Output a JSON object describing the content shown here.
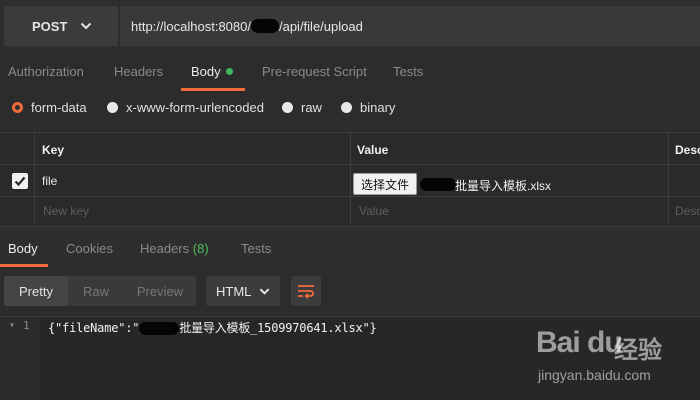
{
  "request": {
    "method": "POST",
    "url_prefix": "http://localhost:8080/",
    "url_suffix": "/api/file/upload"
  },
  "request_tabs": [
    {
      "label": "Authorization"
    },
    {
      "label": "Headers"
    },
    {
      "label": "Body",
      "active": true,
      "indicator_color": "#3fb85c"
    },
    {
      "label": "Pre-request Script"
    },
    {
      "label": "Tests"
    }
  ],
  "body_types": [
    {
      "label": "form-data",
      "selected": true
    },
    {
      "label": "x-www-form-urlencoded"
    },
    {
      "label": "raw"
    },
    {
      "label": "binary"
    }
  ],
  "params_table": {
    "columns": [
      "Key",
      "Value",
      "Desc"
    ],
    "rows": [
      {
        "checked": true,
        "key": "file",
        "file_button": "选择文件",
        "file_name": "批量导入模板.xlsx"
      }
    ],
    "placeholders": {
      "key": "New key",
      "value": "Value",
      "description": "Desc"
    }
  },
  "response_tabs": [
    {
      "label": "Body",
      "active": true
    },
    {
      "label": "Cookies"
    },
    {
      "label": "Headers",
      "count": "(8)"
    },
    {
      "label": "Tests"
    }
  ],
  "view_modes": [
    {
      "label": "Pretty",
      "selected": true
    },
    {
      "label": "Raw"
    },
    {
      "label": "Preview"
    }
  ],
  "format": "HTML",
  "response_body": {
    "line_number": "1",
    "prefix": "{\"fileName\":\"",
    "suffix": "批量导入模板_1509970641.xlsx\"}"
  },
  "watermark": {
    "logo": "Bai du",
    "brand": "经验",
    "url": "jingyan.baidu.com"
  },
  "colors": {
    "accent": "#f26b3a",
    "background": "#2c2c2c",
    "success": "#3fb85c"
  }
}
